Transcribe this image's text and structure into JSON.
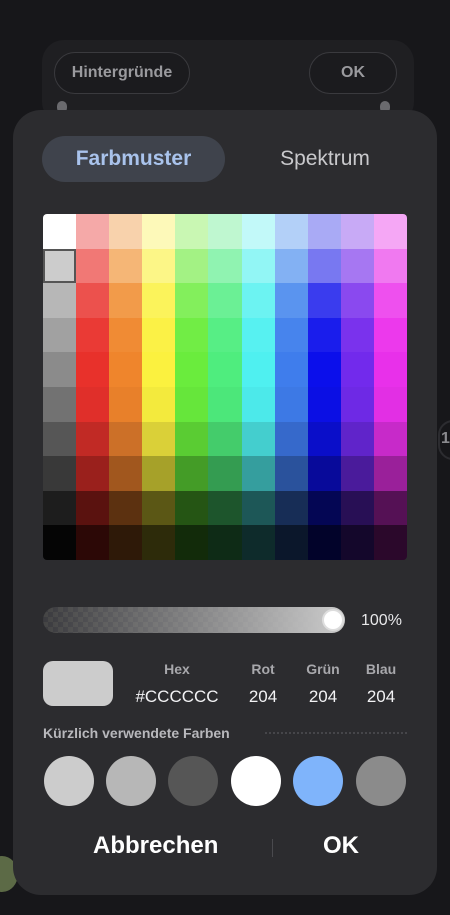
{
  "background": {
    "left_button": "Hintergründe",
    "right_button": "OK",
    "edge_glyph": "1"
  },
  "tabs": {
    "swatches": "Farbmuster",
    "spectrum": "Spektrum"
  },
  "palette": {
    "rows": [
      [
        "#ffffff",
        "#f5a9a8",
        "#f8d2ac",
        "#fdf9b9",
        "#c9f7b3",
        "#bff7d0",
        "#c2f9f9",
        "#b3d0f8",
        "#a9aaf5",
        "#c8aaf6",
        "#f5a7f5"
      ],
      [
        "#cccccc",
        "#f17875",
        "#f5b676",
        "#fcf687",
        "#a3f284",
        "#90f3b1",
        "#92f6f5",
        "#83b1f3",
        "#7878f1",
        "#a677f2",
        "#f079f0"
      ],
      [
        "#b7b7b7",
        "#ec514d",
        "#f29b4a",
        "#fbf35b",
        "#83ef5c",
        "#6bf095",
        "#6cf3f2",
        "#5a94ef",
        "#3a3cee",
        "#8a49ef",
        "#ee50ee"
      ],
      [
        "#a1a1a1",
        "#ea3a35",
        "#f08b34",
        "#fbf146",
        "#71ed45",
        "#57ee85",
        "#57f1f1",
        "#4784ed",
        "#1a1dec",
        "#7a32ed",
        "#ec39ec"
      ],
      [
        "#8b8b8b",
        "#e8312b",
        "#ef852c",
        "#fbf13f",
        "#6aec3d",
        "#4fed7e",
        "#4ff0f0",
        "#3f7dec",
        "#0b0feb",
        "#722aec",
        "#e830ea"
      ],
      [
        "#727272",
        "#e02f2a",
        "#e8802a",
        "#f3ea3d",
        "#66e63b",
        "#4ce77a",
        "#4ce9ea",
        "#3d79e5",
        "#0b0fe4",
        "#6e29e5",
        "#e22fe4"
      ],
      [
        "#565656",
        "#c12a25",
        "#cc7028",
        "#dad038",
        "#5acc33",
        "#44cc6b",
        "#44cece",
        "#3669cb",
        "#0a0ec9",
        "#6024ca",
        "#c72ac9"
      ],
      [
        "#393939",
        "#9a201c",
        "#a1571e",
        "#a6a129",
        "#449c27",
        "#349c51",
        "#359e9e",
        "#2a529c",
        "#080a9a",
        "#4a1b9b",
        "#9a209a"
      ],
      [
        "#1d1d1d",
        "#5a120f",
        "#5c3110",
        "#5b5715",
        "#255514",
        "#1d552c",
        "#1d5757",
        "#172d56",
        "#040654",
        "#280f55",
        "#551155"
      ],
      [
        "#050505",
        "#2c0806",
        "#2e1908",
        "#2d2b0a",
        "#122b0a",
        "#0e2b16",
        "#0e2b2b",
        "#0b172b",
        "#02032a",
        "#14072b",
        "#2b082b"
      ]
    ],
    "selected": "#cccccc"
  },
  "opacity": {
    "value_label": "100%",
    "fraction": 1.0
  },
  "color": {
    "preview_hex": "#CCCCCC",
    "headers": {
      "hex": "Hex",
      "red": "Rot",
      "green": "Grün",
      "blue": "Blau"
    },
    "values": {
      "hex": "#CCCCCC",
      "red": "204",
      "green": "204",
      "blue": "204"
    }
  },
  "recent": {
    "label": "Kürzlich verwendete Farben",
    "colors": [
      "#cccccc",
      "#b7b7b7",
      "#565656",
      "#ffffff",
      "#7fb4fb",
      "#8b8b8b"
    ]
  },
  "actions": {
    "cancel": "Abbrechen",
    "ok": "OK"
  }
}
